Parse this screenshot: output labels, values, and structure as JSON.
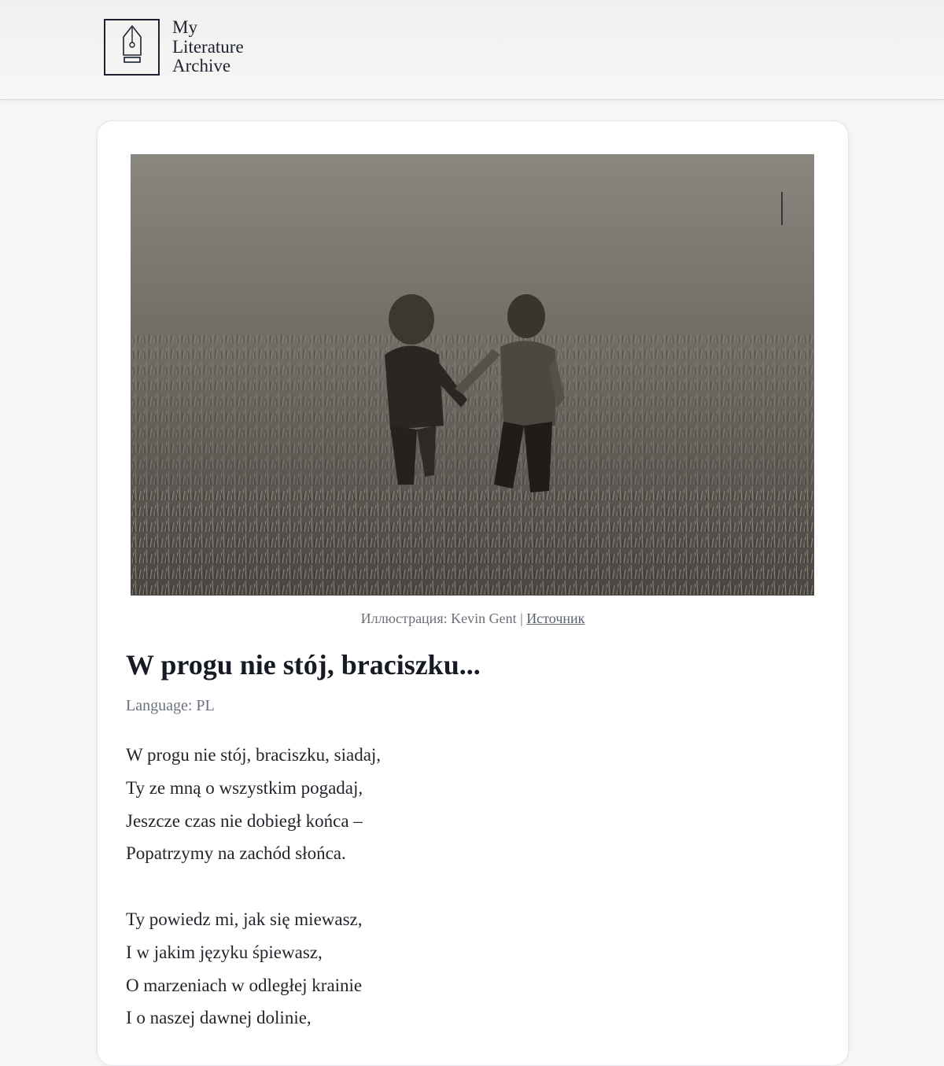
{
  "header": {
    "logo_icon": "fountain-pen-nib-icon",
    "logo_lines": [
      "My",
      "Literature",
      "Archive"
    ]
  },
  "article": {
    "image_alt": "Two small children walking hand in hand through a grassy field (black and white photo)",
    "caption_prefix": "Иллюстрация: Kevin Gent | ",
    "caption_link": "Источник",
    "title": "W progu nie stój, braciszku...",
    "language": "Language: PL",
    "stanzas": [
      [
        "W progu nie stój, braciszku, siadaj,",
        "Ty ze mną o wszystkim pogadaj,",
        "Jeszcze czas nie dobiegł końca –",
        "Popatrzymy na zachód słońca."
      ],
      [
        "Ty powiedz mi, jak się miewasz,",
        "I w jakim języku śpiewasz,",
        "O marzeniach w odległej krainie",
        "I o naszej dawnej dolinie,"
      ]
    ]
  },
  "colors": {
    "page_bg": "#f4f6f8",
    "card_bg": "#ffffff",
    "text": "#1f2126",
    "muted": "#6b7180"
  }
}
